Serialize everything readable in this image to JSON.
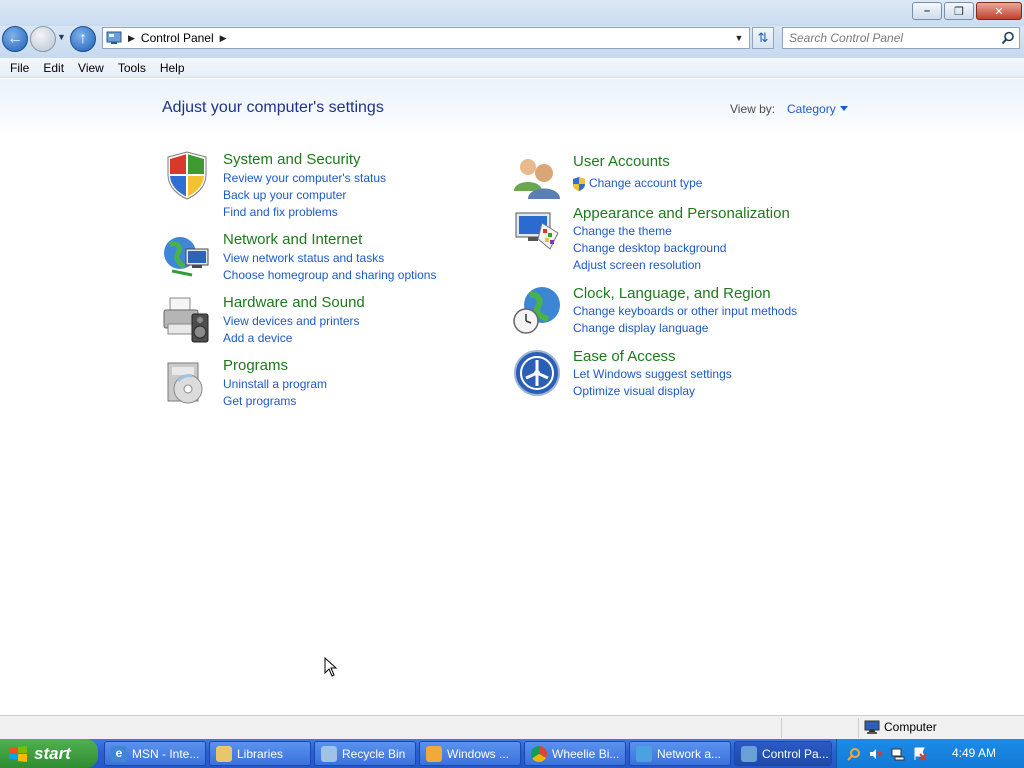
{
  "window": {
    "minimize": "–",
    "restore": "❐",
    "close": "✕"
  },
  "address": {
    "crumb": "Control Panel",
    "search_placeholder": "Search Control Panel"
  },
  "menu": [
    "File",
    "Edit",
    "View",
    "Tools",
    "Help"
  ],
  "page": {
    "title": "Adjust your computer's settings",
    "view_by_label": "View by:",
    "view_by_value": "Category"
  },
  "categories": [
    {
      "title": "System and Security",
      "icon": "shield-icon",
      "links": [
        "Review your computer's status",
        "Back up your computer",
        "Find and fix problems"
      ]
    },
    {
      "title": "Network and Internet",
      "icon": "network-icon",
      "links": [
        "View network status and tasks",
        "Choose homegroup and sharing options"
      ]
    },
    {
      "title": "Hardware and Sound",
      "icon": "printer-speaker-icon",
      "links": [
        "View devices and printers",
        "Add a device"
      ]
    },
    {
      "title": "Programs",
      "icon": "programs-icon",
      "links": [
        "Uninstall a program",
        "Get programs"
      ]
    },
    {
      "title": "User Accounts",
      "icon": "users-icon",
      "links": [
        "Change account type"
      ]
    },
    {
      "title": "Appearance and Personalization",
      "icon": "monitor-palette-icon",
      "links": [
        "Change the theme",
        "Change desktop background",
        "Adjust screen resolution"
      ]
    },
    {
      "title": "Clock, Language, and Region",
      "icon": "globe-clock-icon",
      "links": [
        "Change keyboards or other input methods",
        "Change display language"
      ]
    },
    {
      "title": "Ease of Access",
      "icon": "ease-of-access-icon",
      "links": [
        "Let Windows suggest settings",
        "Optimize visual display"
      ]
    }
  ],
  "statusbar": {
    "zone": "Computer"
  },
  "taskbar": {
    "start": "start",
    "tasks": [
      "MSN - Inte...",
      "Libraries",
      "Recycle Bin",
      "Windows ...",
      "Wheelie Bi...",
      "Network a...",
      "Control Pa..."
    ],
    "clock": "4:49 AM"
  },
  "colors": {
    "title": "#1e3287",
    "category": "#1d7a1d",
    "link": "#1e5ac8",
    "taskbar": "#2b5fd2",
    "start": "#2f8d31"
  }
}
